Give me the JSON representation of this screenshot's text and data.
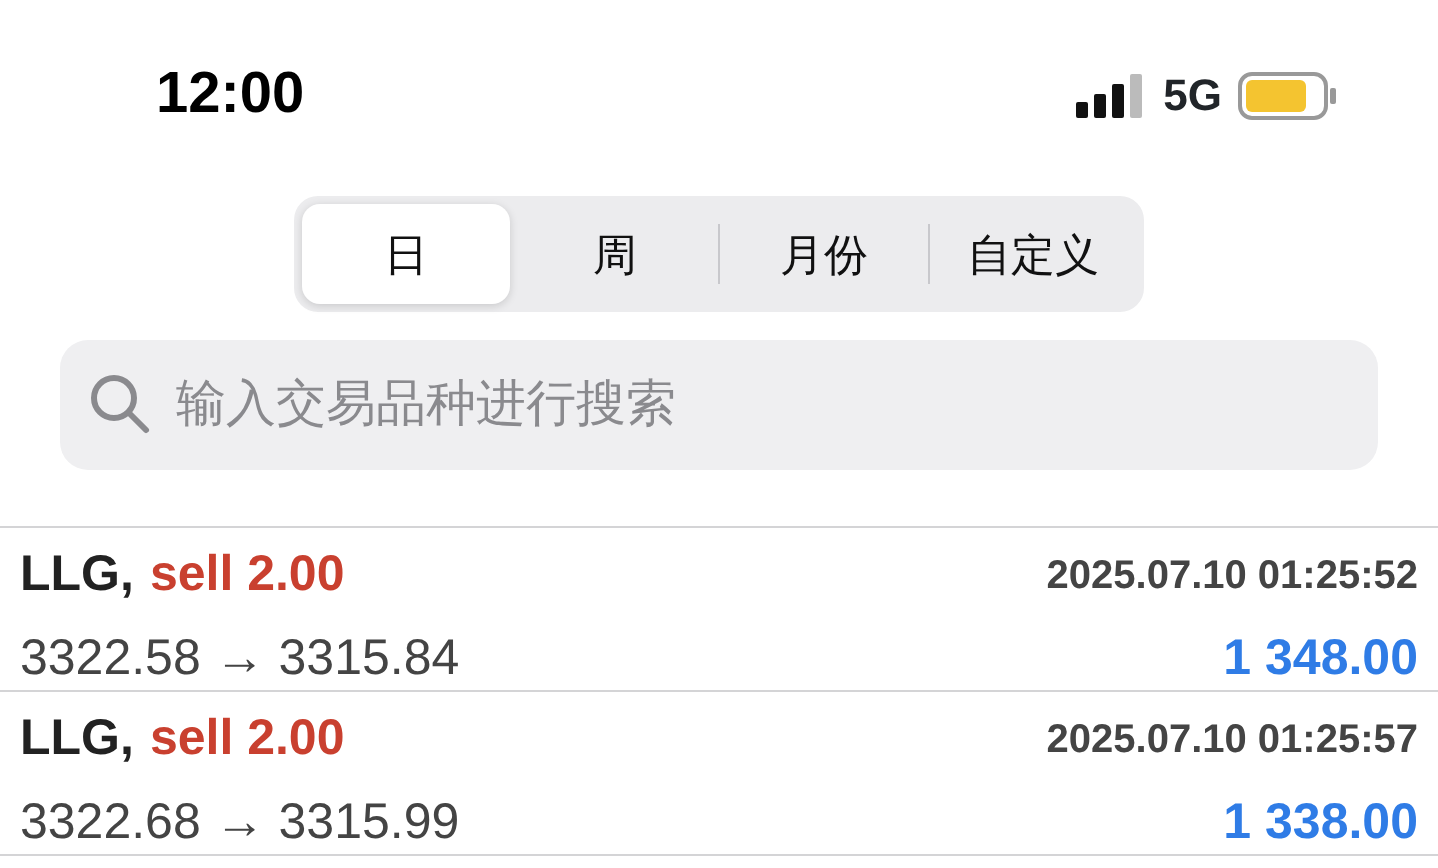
{
  "status_bar": {
    "time": "12:00",
    "network": "5G"
  },
  "segments": [
    {
      "label": "日",
      "selected": true
    },
    {
      "label": "周",
      "selected": false
    },
    {
      "label": "月份",
      "selected": false
    },
    {
      "label": "自定义",
      "selected": false
    }
  ],
  "search": {
    "placeholder": "输入交易品种进行搜索"
  },
  "trades": [
    {
      "symbol": "LLG,",
      "side": "sell 2.00",
      "time": "2025.07.10 01:25:52",
      "prices": "3322.58 → 3315.84",
      "profit": "1 348.00"
    },
    {
      "symbol": "LLG,",
      "side": "sell 2.00",
      "time": "2025.07.10 01:25:57",
      "prices": "3322.68 → 3315.99",
      "profit": "1 338.00"
    }
  ]
}
